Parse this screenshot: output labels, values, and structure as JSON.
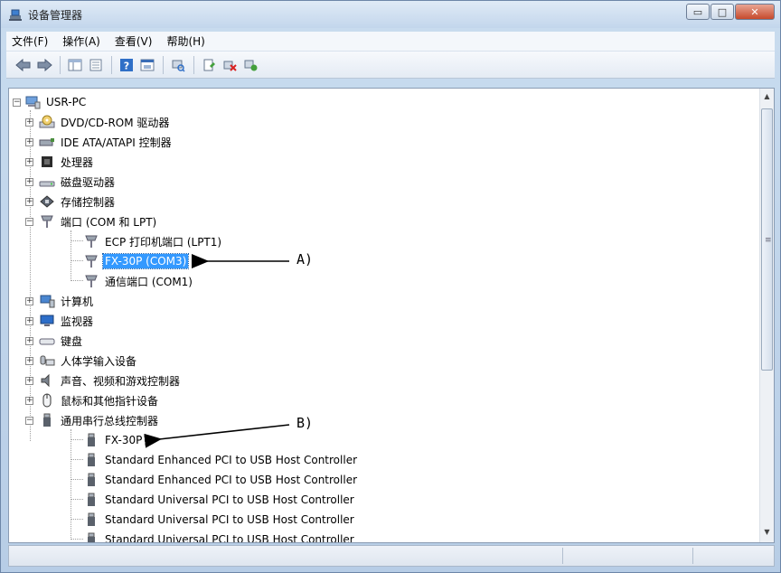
{
  "window": {
    "title": "设备管理器",
    "controls": {
      "minimize": "▭",
      "maximize": "□",
      "close": "✕"
    }
  },
  "menubar": {
    "items": [
      "文件(F)",
      "操作(A)",
      "查看(V)",
      "帮助(H)"
    ]
  },
  "toolbar": {
    "icons": [
      "back-icon",
      "forward-icon",
      "properties-grid-icon",
      "list-icon",
      "help-icon",
      "view-icon",
      "scan-hardware-icon",
      "update-driver-icon",
      "uninstall-icon",
      "enable-device-icon"
    ]
  },
  "tree": {
    "root": "USR-PC",
    "categories": [
      "DVD/CD-ROM 驱动器",
      "IDE ATA/ATAPI 控制器",
      "处理器",
      "磁盘驱动器",
      "存储控制器",
      "端口 (COM 和 LPT)",
      "计算机",
      "监视器",
      "键盘",
      "人体学输入设备",
      "声音、视频和游戏控制器",
      "鼠标和其他指针设备",
      "通用串行总线控制器"
    ],
    "ports_children": [
      "ECP 打印机端口 (LPT1)",
      "FX-30P (COM3)",
      "通信端口 (COM1)"
    ],
    "usb_children": [
      "FX-30P",
      "Standard Enhanced PCI to USB Host Controller",
      "Standard Enhanced PCI to USB Host Controller",
      "Standard Universal PCI to USB Host Controller",
      "Standard Universal PCI to USB Host Controller",
      "Standard Universal PCI to USB Host Controller"
    ]
  },
  "annotations": {
    "a": "A)",
    "b": "B)"
  },
  "scrollbar": {
    "up": "▲",
    "down": "▼",
    "grip": "≡"
  },
  "expander": {
    "collapsed": "+",
    "expanded": "−"
  }
}
